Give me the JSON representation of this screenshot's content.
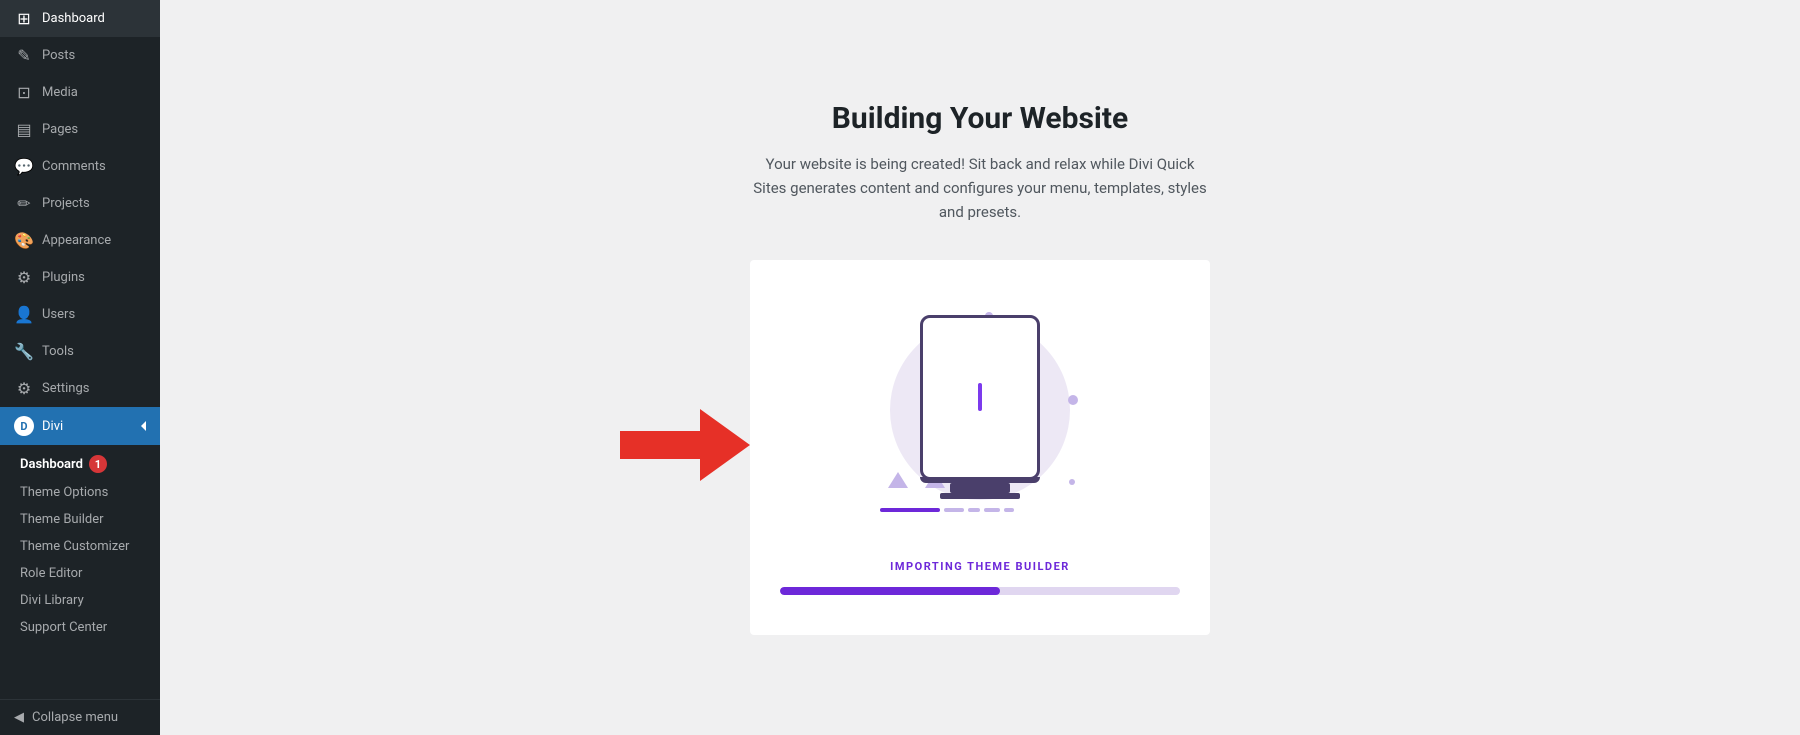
{
  "sidebar": {
    "items": [
      {
        "id": "dashboard",
        "label": "Dashboard",
        "icon": "⊞"
      },
      {
        "id": "posts",
        "label": "Posts",
        "icon": "✎"
      },
      {
        "id": "media",
        "label": "Media",
        "icon": "⊡"
      },
      {
        "id": "pages",
        "label": "Pages",
        "icon": "▤"
      },
      {
        "id": "comments",
        "label": "Comments",
        "icon": "💬"
      },
      {
        "id": "projects",
        "label": "Projects",
        "icon": "✏"
      },
      {
        "id": "appearance",
        "label": "Appearance",
        "icon": "🎨"
      },
      {
        "id": "plugins",
        "label": "Plugins",
        "icon": "⚙"
      },
      {
        "id": "users",
        "label": "Users",
        "icon": "👤"
      },
      {
        "id": "tools",
        "label": "Tools",
        "icon": "🔧"
      },
      {
        "id": "settings",
        "label": "Settings",
        "icon": "⚙"
      }
    ],
    "divi": {
      "label": "Divi",
      "submenu": [
        {
          "id": "divi-dashboard",
          "label": "Dashboard",
          "badge": "1"
        },
        {
          "id": "theme-options",
          "label": "Theme Options"
        },
        {
          "id": "theme-builder",
          "label": "Theme Builder"
        },
        {
          "id": "theme-customizer",
          "label": "Theme Customizer"
        },
        {
          "id": "role-editor",
          "label": "Role Editor"
        },
        {
          "id": "divi-library",
          "label": "Divi Library"
        },
        {
          "id": "support-center",
          "label": "Support Center"
        }
      ]
    },
    "collapse_label": "Collapse menu"
  },
  "main": {
    "title": "Building Your Website",
    "subtitle": "Your website is being created! Sit back and relax while Divi Quick Sites generates content and configures your menu, templates, styles and presets.",
    "status_label": "IMPORTING THEME BUILDER",
    "progress_percent": 55
  }
}
